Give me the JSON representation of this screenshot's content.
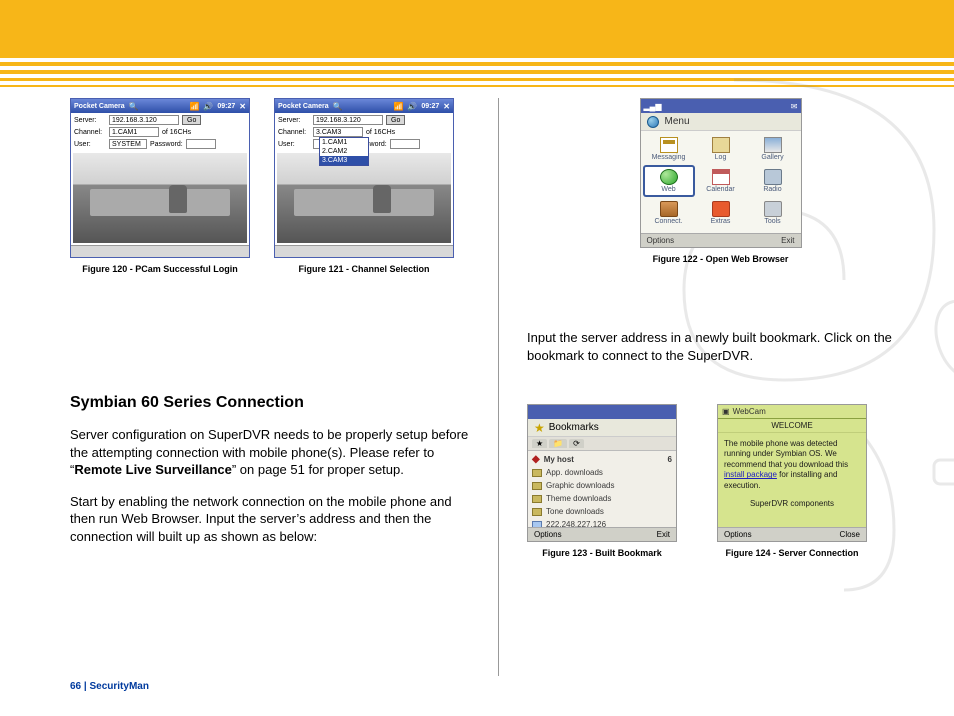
{
  "figures": {
    "f120": "Figure 120 - PCam Successful Login",
    "f121": "Figure 121 - Channel Selection",
    "f122": "Figure 122 - Open Web Browser",
    "f123": "Figure 123 - Built Bookmark",
    "f124": "Figure 124 - Server Connection"
  },
  "pcam": {
    "title": "Pocket Camera",
    "time": "09:27",
    "serverLabel": "Server:",
    "server": "192.168.3.120",
    "go": "Go",
    "channelLabel": "Channel:",
    "channelA": "1.CAM1",
    "channelB": "3.CAM3",
    "of": "of 16CHs",
    "userLabel": "User:",
    "user": "SYSTEM",
    "passLabel": "Password:",
    "dropdown": [
      "1.CAM1",
      "2.CAM2",
      "3.CAM3"
    ]
  },
  "heading": "Symbian 60 Series Connection",
  "p1a": "Server configuration on SuperDVR needs to be properly setup before the attempting connection with mobile phone(s). Please refer to “",
  "p1b": "Remote Live Surveillance",
  "p1c": "” on page 51 for proper setup.",
  "p2": "Start by enabling the network connection on the mobile phone and then run Web Browser.  Input the server’s address and then the connection will built up as shown as below:",
  "pr": "Input the server address in a newly built bookmark. Click on the bookmark to connect to the SuperDVR.",
  "phoneMenu": {
    "title": "Menu",
    "items": [
      "Messaging",
      "Log",
      "Gallery",
      "Web",
      "Calendar",
      "Radio",
      "Connect.",
      "Extras",
      "Tools"
    ],
    "softLeft": "Options",
    "softRight": "Exit"
  },
  "bookmarks": {
    "title": "Bookmarks",
    "count": "6",
    "items": [
      "My host",
      "App. downloads",
      "Graphic downloads",
      "Theme downloads",
      "Tone downloads",
      "222.248.227.126"
    ],
    "softLeft": "Options",
    "softRight": "Exit"
  },
  "webcam": {
    "title": "WebCam",
    "welcome": "WELCOME",
    "body1": "The mobile phone was detected running under Symbian OS. We recommend that you download this ",
    "link": "install package",
    "body2": " for installing and execution.",
    "sub": "SuperDVR components",
    "softLeft": "Options",
    "softRight": "Close"
  },
  "footer": "66   |  SecurityMan"
}
